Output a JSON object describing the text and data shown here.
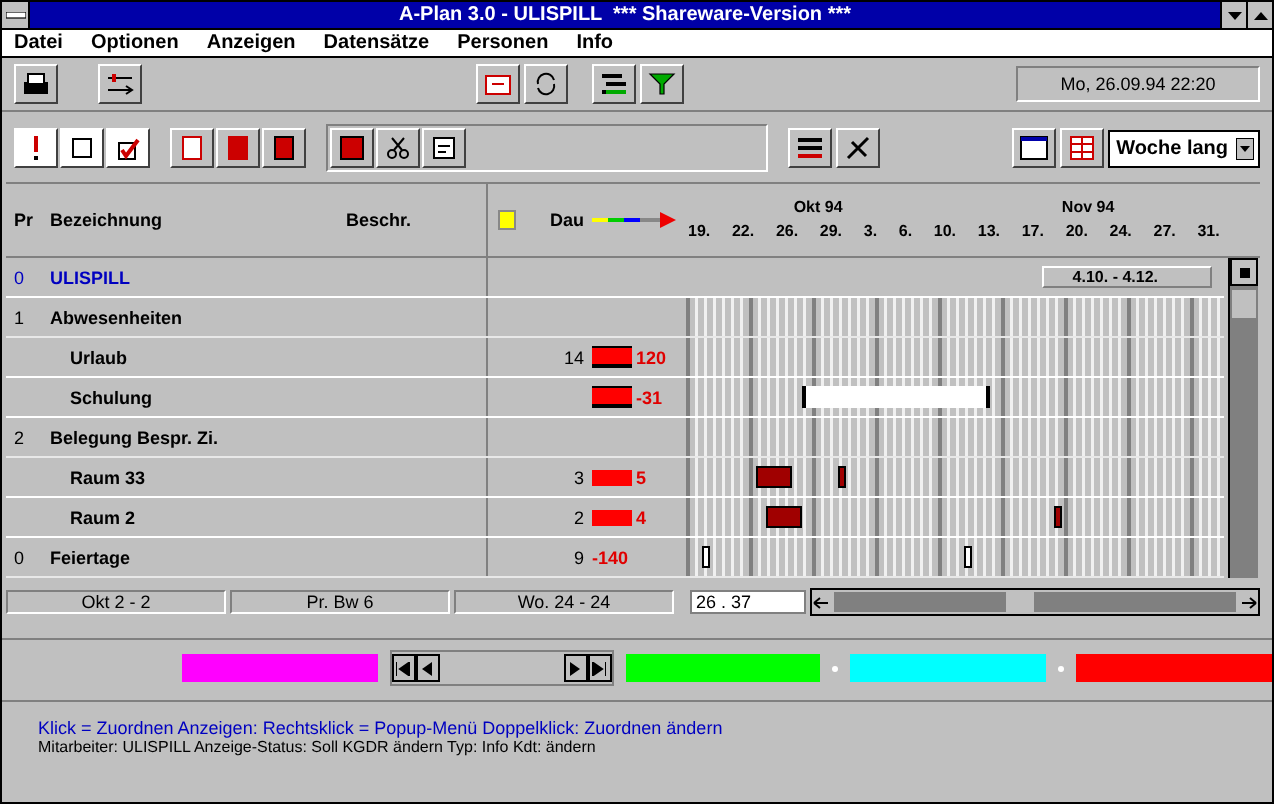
{
  "window": {
    "title": "A-Plan 3.0 - ULISPILL  *** Shareware-Version ***"
  },
  "menu": [
    "Datei",
    "Optionen",
    "Anzeigen",
    "Datensätze",
    "Personen",
    "Info"
  ],
  "clock": "Mo, 26.09.94 22:20",
  "view_select": {
    "value": "Woche lang"
  },
  "columns": [
    "Pr",
    "Bezeichnung",
    "Beschr.",
    "Dau"
  ],
  "timeline": {
    "months": [
      {
        "label": "Okt 94"
      },
      {
        "label": "Nov 94"
      }
    ],
    "days": [
      "19.",
      "22.",
      "26.",
      "29.",
      "3.",
      "6.",
      "10.",
      "13.",
      "17.",
      "20.",
      "24.",
      "27.",
      "31."
    ],
    "range": "4.10. - 4.12."
  },
  "rows": [
    {
      "num": "0",
      "label": "ULISPILL",
      "kind": "project",
      "children": [
        {
          "num": "1",
          "label": "Abwesenheiten",
          "kind": "group",
          "children": [
            {
              "label": "Urlaub",
              "kind": "item",
              "duration": "14",
              "bar": true,
              "reading": "120"
            },
            {
              "label": "Schulung",
              "kind": "item",
              "bar": true,
              "reading": "-31"
            }
          ]
        },
        {
          "num": "2",
          "label": "Belegung Bespr. Zi.",
          "kind": "group",
          "children": [
            {
              "label": "Raum 33",
              "kind": "item",
              "duration": "3",
              "bar": false,
              "reading": "5"
            },
            {
              "label": "Raum 2",
              "kind": "item",
              "duration": "2",
              "bar": false,
              "reading": "4"
            }
          ]
        },
        {
          "num": "0",
          "label": "Feiertage",
          "kind": "group",
          "duration": "9",
          "reading": "-140"
        }
      ]
    }
  ],
  "status": [
    "Okt 2 - 2",
    "Pr. Bw 6",
    "Wo. 24 - 24"
  ],
  "position": {
    "value": "26 . 37"
  },
  "colors": [
    {
      "color": "#ff00ff"
    },
    {
      "color": "#00ff00"
    },
    {
      "color": "#00ffff"
    },
    {
      "color": "#ff0000"
    }
  ],
  "help": [
    "Klick = Zuordnen  Anzeigen: Rechtsklick = Popup-Menü  Doppelklick: Zuordnen ändern",
    "Mitarbeiter: ULISPILL  Anzeige-Status: Soll KGDR ändern  Typ: Info  Kdt: ändern"
  ]
}
